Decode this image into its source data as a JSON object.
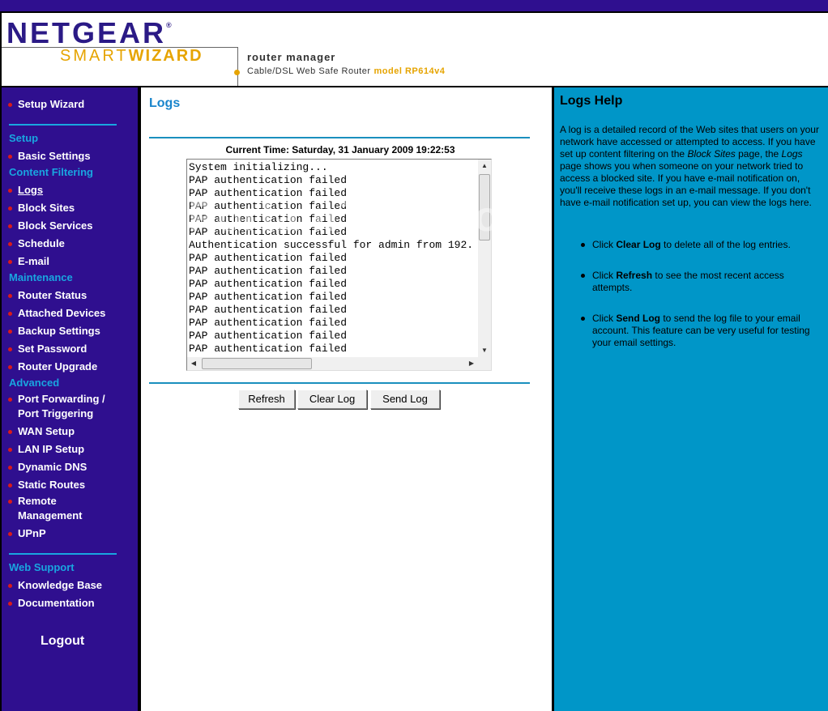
{
  "header": {
    "brand": "NETGEAR",
    "trademark": "®",
    "smart": "SMART",
    "wizard": "WIZARD",
    "router_manager": "router manager",
    "subtitle": "Cable/DSL Web Safe Router",
    "model": "model RP614v4"
  },
  "sidebar": {
    "setup_wizard": "Setup Wizard",
    "sections": {
      "setup": "Setup",
      "content_filtering": "Content Filtering",
      "maintenance": "Maintenance",
      "advanced": "Advanced",
      "web_support": "Web Support"
    },
    "items": {
      "basic_settings": "Basic Settings",
      "logs": "Logs",
      "block_sites": "Block Sites",
      "block_services": "Block Services",
      "schedule": "Schedule",
      "email": "E-mail",
      "router_status": "Router Status",
      "attached_devices": "Attached Devices",
      "backup_settings": "Backup Settings",
      "set_password": "Set Password",
      "router_upgrade": "Router Upgrade",
      "port_forwarding_1": "Port Forwarding /",
      "port_forwarding_2": "Port Triggering",
      "wan_setup": "WAN Setup",
      "lan_ip_setup": "LAN IP Setup",
      "dynamic_dns": "Dynamic DNS",
      "static_routes": "Static Routes",
      "remote_management_1": "Remote",
      "remote_management_2": "Management",
      "upnp": "UPnP",
      "knowledge_base": "Knowledge Base",
      "documentation": "Documentation"
    },
    "logout": "Logout"
  },
  "main": {
    "title": "Logs",
    "current_time": "Current Time: Saturday, 31 January 2009 19:22:53",
    "log_text": "System initializing...\nPAP authentication failed\nPAP authentication failed\nPAP authentication failed\nPAP authentication failed\nPAP authentication failed\nAuthentication successful for admin from 192.\nPAP authentication failed\nPAP authentication failed\nPAP authentication failed\nPAP authentication failed\nPAP authentication failed\nPAP authentication failed\nPAP authentication failed\nPAP authentication failed",
    "buttons": {
      "refresh": "Refresh",
      "clear_log": "Clear Log",
      "send_log": "Send Log"
    }
  },
  "help": {
    "title": "Logs Help",
    "intro_a": "A log is a detailed record of the Web sites that users on your network have accessed or attempted to access. If you have set up content filtering on the ",
    "intro_b": "Block Sites",
    "intro_c": " page, the ",
    "intro_d": "Logs",
    "intro_e": " page shows you when someone on your network tried to access a blocked site. If you have e-mail notification on, you'll receive these logs in an e-mail message. If you don't have e-mail notification set up, you can view the logs here.",
    "item1_pre": "Click ",
    "item1_bold": "Clear Log",
    "item1_post": " to delete all of the log entries.",
    "item2_pre": "Click ",
    "item2_bold": "Refresh",
    "item2_post": " to see the most recent access attempts.",
    "item3_pre": "Click ",
    "item3_bold": "Send Log",
    "item3_post": " to send the log file to your email account. This feature can be very useful for testing your email settings."
  },
  "watermark": "PortalnTech.com",
  "colors": {
    "sidebar_bg": "#2f0f8f",
    "section_heading": "#19a6e0",
    "bullet": "#d91a1a",
    "help_bg": "#0096c8",
    "title_blue": "#1985cc"
  }
}
